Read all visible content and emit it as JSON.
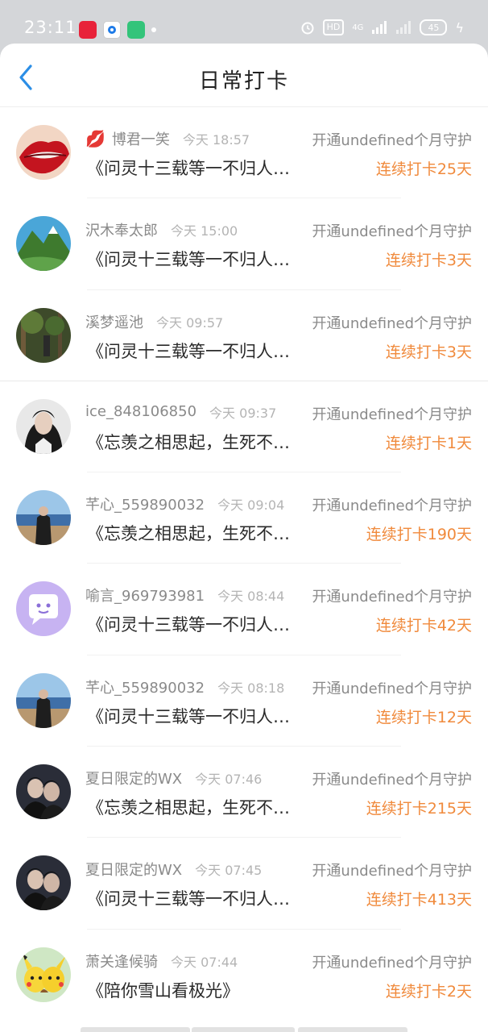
{
  "status_bar": {
    "time": "23:11",
    "battery": "45",
    "hd_label": "HD",
    "network": "4G"
  },
  "nav": {
    "title": "日常打卡"
  },
  "items": [
    {
      "name": "博君一笑",
      "time": "今天 18:57",
      "guard": "开通undefined个月守护",
      "title": "《问灵十三载等一不归人…",
      "streak": "连续打卡25天",
      "has_lips": true
    },
    {
      "name": "沢木奉太郎",
      "time": "今天 15:00",
      "guard": "开通undefined个月守护",
      "title": "《问灵十三载等一不归人…",
      "streak": "连续打卡3天",
      "has_lips": false
    },
    {
      "name": "溪梦遥池",
      "time": "今天 09:57",
      "guard": "开通undefined个月守护",
      "title": "《问灵十三载等一不归人…",
      "streak": "连续打卡3天",
      "has_lips": false
    },
    {
      "name": "ice_848106850",
      "time": "今天 09:37",
      "guard": "开通undefined个月守护",
      "title": "《忘羡之相思起，生死不…",
      "streak": "连续打卡1天",
      "has_lips": false
    },
    {
      "name": "芊心_559890032",
      "time": "今天 09:04",
      "guard": "开通undefined个月守护",
      "title": "《忘羡之相思起，生死不…",
      "streak": "连续打卡190天",
      "has_lips": false
    },
    {
      "name": "喻言_969793981",
      "time": "今天 08:44",
      "guard": "开通undefined个月守护",
      "title": "《问灵十三载等一不归人…",
      "streak": "连续打卡42天",
      "has_lips": false
    },
    {
      "name": "芊心_559890032",
      "time": "今天 08:18",
      "guard": "开通undefined个月守护",
      "title": "《问灵十三载等一不归人…",
      "streak": "连续打卡12天",
      "has_lips": false
    },
    {
      "name": "夏日限定的WX",
      "time": "今天 07:46",
      "guard": "开通undefined个月守护",
      "title": "《忘羡之相思起，生死不…",
      "streak": "连续打卡215天",
      "has_lips": false
    },
    {
      "name": "夏日限定的WX",
      "time": "今天 07:45",
      "guard": "开通undefined个月守护",
      "title": "《问灵十三载等一不归人…",
      "streak": "连续打卡413天",
      "has_lips": false
    },
    {
      "name": "萧关逢候骑",
      "time": "今天 07:44",
      "guard": "开通undefined个月守护",
      "title": "《陪你雪山看极光》",
      "streak": "连续打卡2天",
      "has_lips": false
    }
  ]
}
